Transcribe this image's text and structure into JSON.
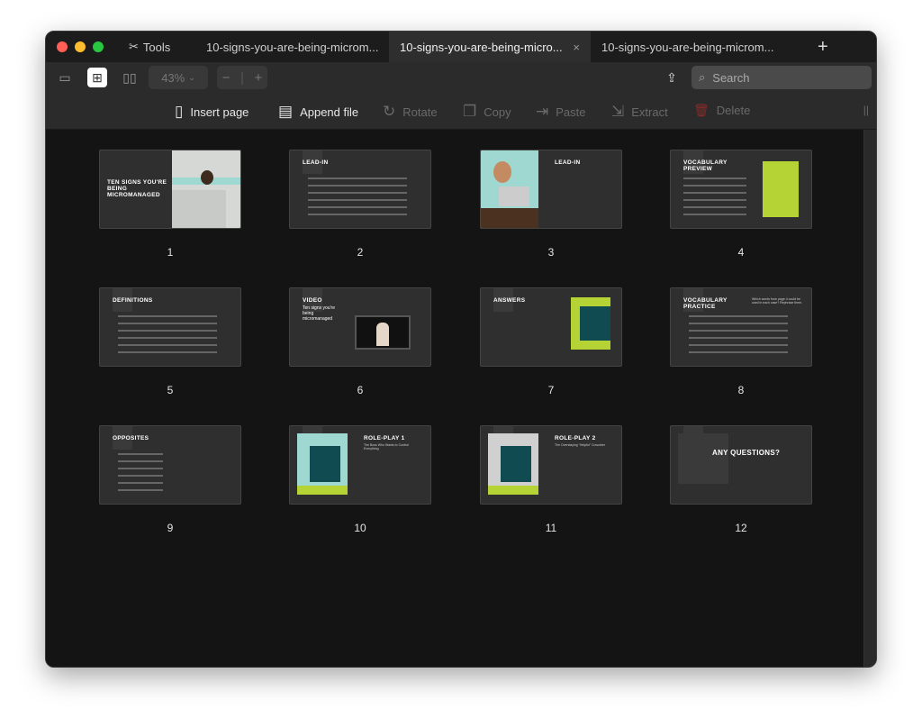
{
  "window": {
    "traffic_lights": [
      "#ff5f57",
      "#febc2e",
      "#28c840"
    ]
  },
  "tabs": {
    "tools_label": "Tools",
    "items": [
      {
        "label": "10-signs-you-are-being-microm...",
        "active": false
      },
      {
        "label": "10-signs-you-are-being-micro...",
        "active": true
      },
      {
        "label": "10-signs-you-are-being-microm...",
        "active": false
      }
    ],
    "close": "×",
    "new_tab": "+"
  },
  "toolbar": {
    "zoom": "43%",
    "zoom_minus": "−",
    "zoom_plus": "+",
    "search_placeholder": "Search"
  },
  "actions": [
    {
      "label": "Insert page",
      "icon": "insert-page-icon",
      "enabled": true
    },
    {
      "label": "Append file",
      "icon": "pdf-append-icon",
      "enabled": true
    },
    {
      "label": "Rotate",
      "icon": "rotate-icon",
      "enabled": false
    },
    {
      "label": "Copy",
      "icon": "copy-icon",
      "enabled": false
    },
    {
      "label": "Paste",
      "icon": "paste-icon",
      "enabled": false
    },
    {
      "label": "Extract",
      "icon": "extract-icon",
      "enabled": false
    },
    {
      "label": "Delete",
      "icon": "trash-icon",
      "enabled": false
    }
  ],
  "pages": [
    {
      "number": "1",
      "title": "TEN SIGNS YOU'RE BEING MICROMANAGED",
      "subtitle": ""
    },
    {
      "number": "2",
      "title": "LEAD-IN",
      "subtitle": ""
    },
    {
      "number": "3",
      "title": "LEAD-IN",
      "subtitle": ""
    },
    {
      "number": "4",
      "title": "VOCABULARY PREVIEW",
      "subtitle": ""
    },
    {
      "number": "5",
      "title": "DEFINITIONS",
      "subtitle": ""
    },
    {
      "number": "6",
      "title": "VIDEO",
      "subtitle": "Ten signs you're being micromanaged"
    },
    {
      "number": "7",
      "title": "ANSWERS",
      "subtitle": ""
    },
    {
      "number": "8",
      "title": "VOCABULARY PRACTICE",
      "subtitle": "Which words from page 4 could be used in each case? Rephrase them."
    },
    {
      "number": "9",
      "title": "OPPOSITES",
      "subtitle": ""
    },
    {
      "number": "10",
      "title": "ROLE-PLAY 1",
      "subtitle": "The Boss Who Wants to Control Everything"
    },
    {
      "number": "11",
      "title": "ROLE-PLAY 2",
      "subtitle": "The Overstaying \"Helpful\" Coworker"
    },
    {
      "number": "12",
      "title": "ANY QUESTIONS?",
      "subtitle": ""
    }
  ],
  "colors": {
    "accent_green": "#b5d334",
    "teal": "#0f4b50",
    "mint": "#9fd8d0"
  }
}
